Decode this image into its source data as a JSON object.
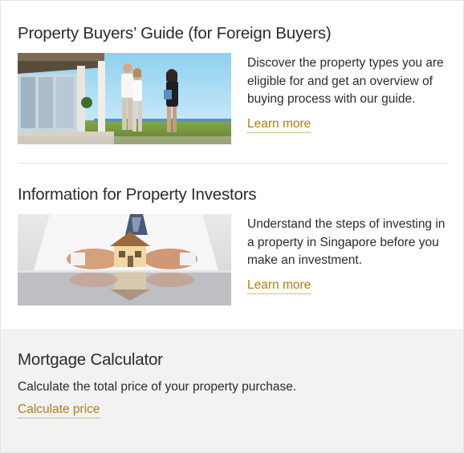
{
  "buyers_guide": {
    "title": "Property Buyers’ Guide (for Foreign Buyers)",
    "description": "Discover the property types you are eligible for and get an overview of buying process with our guide.",
    "link_label": "Learn more"
  },
  "investors": {
    "title": "Information for Property Investors",
    "description": "Understand the steps of investing in a property in Singapore before you make an investment.",
    "link_label": "Learn more"
  },
  "mortgage": {
    "title": "Mortgage Calculator",
    "description": "Calculate the total price of your property purchase.",
    "link_label": "Calculate price"
  },
  "colors": {
    "link": "#b07d12",
    "calculator_background": "#f2f2f2",
    "divider": "#e2e2e2",
    "text": "#2b2b2b"
  }
}
